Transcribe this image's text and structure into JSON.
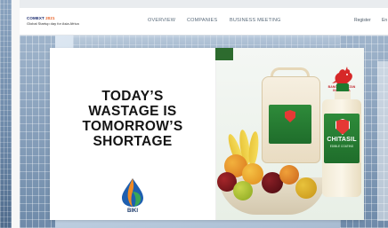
{
  "header": {
    "brand_name_a": "COMEXT",
    "brand_name_b": " 2021",
    "brand_tagline": "Global Startup day for Asia Africa",
    "nav": [
      "OVERVIEW",
      "COMPANIES",
      "BUSINESS MEETING"
    ],
    "register_label": "Register",
    "cutoff_label": "En"
  },
  "banner": {
    "headline_lines": [
      "TODAY’S",
      "WASTAGE IS",
      "TOMORROW’S",
      "SHORTAGE"
    ],
    "biki_label": "BIKI",
    "rooster_text": "BANGGA BUATAN INDONESIA",
    "product_name": "CHITASIL",
    "product_sub": "EDIBLE COATING"
  },
  "colors": {
    "brand_accent": "#e85c1f",
    "brand_primary": "#1a2a6e",
    "product_green": "#2e8b3a",
    "shield_red": "#e53935"
  }
}
